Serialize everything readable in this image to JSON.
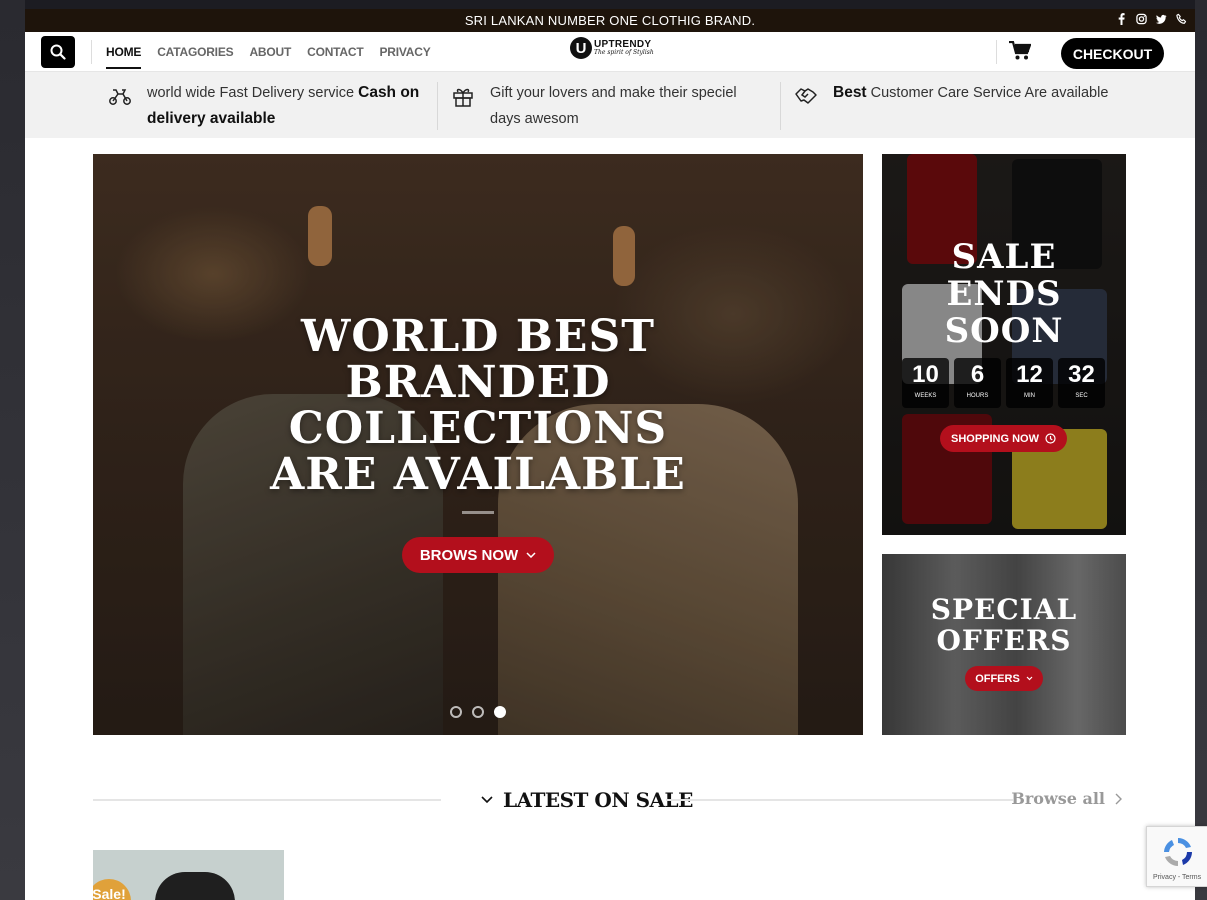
{
  "topbar": {
    "announcement": "SRI LANKAN NUMBER ONE CLOTHIG BRAND.",
    "social_icons": [
      "facebook-icon",
      "instagram-icon",
      "twitter-icon",
      "phone-icon"
    ]
  },
  "header": {
    "nav": [
      "HOME",
      "CATAGORIES",
      "ABOUT",
      "CONTACT",
      "PRIVACY"
    ],
    "active_nav": "HOME",
    "logo": {
      "mark": "U",
      "name": "UPTRENDY",
      "tagline": "The spirit of Stylish"
    },
    "checkout_label": "CHECKOUT"
  },
  "features": [
    {
      "icon": "scooter-icon",
      "text": "world wide Fast Delivery service ",
      "bold": "Cash on",
      "text2": "",
      "bold2": "delivery available"
    },
    {
      "icon": "gift-icon",
      "line1": "Gift your lovers and make their speciel",
      "line2": "days awesom"
    },
    {
      "icon": "handshake-icon",
      "bold": "Best",
      "text": " Customer Care Service Are available"
    }
  ],
  "hero": {
    "title_lines": [
      "WORLD BEST",
      "BRANDED",
      "COLLECTIONS",
      "ARE AVAILABLE"
    ],
    "button_label": "BROWS NOW",
    "slide_count": 3,
    "active_slide": 3
  },
  "sale_box": {
    "title_lines": [
      "SALE",
      "ENDS",
      "SOON"
    ],
    "countdown": [
      {
        "value": "10",
        "unit": "WEEKS"
      },
      {
        "value": "6",
        "unit": "HOURS"
      },
      {
        "value": "12",
        "unit": "MIN"
      },
      {
        "value": "32",
        "unit": "SEC"
      }
    ],
    "button_label": "SHOPPING NOW"
  },
  "offers_box": {
    "title_lines": [
      "SPECIAL",
      "OFFERS"
    ],
    "button_label": "OFFERS"
  },
  "latest": {
    "title": "LATEST ON SALE",
    "browse_label": "Browse all",
    "badge": "Sale!"
  },
  "recaptcha": {
    "links": "Privacy - Terms"
  },
  "colors": {
    "accent": "#b30f1c",
    "topbar": "#1e140b",
    "badge": "#e0a13a"
  }
}
